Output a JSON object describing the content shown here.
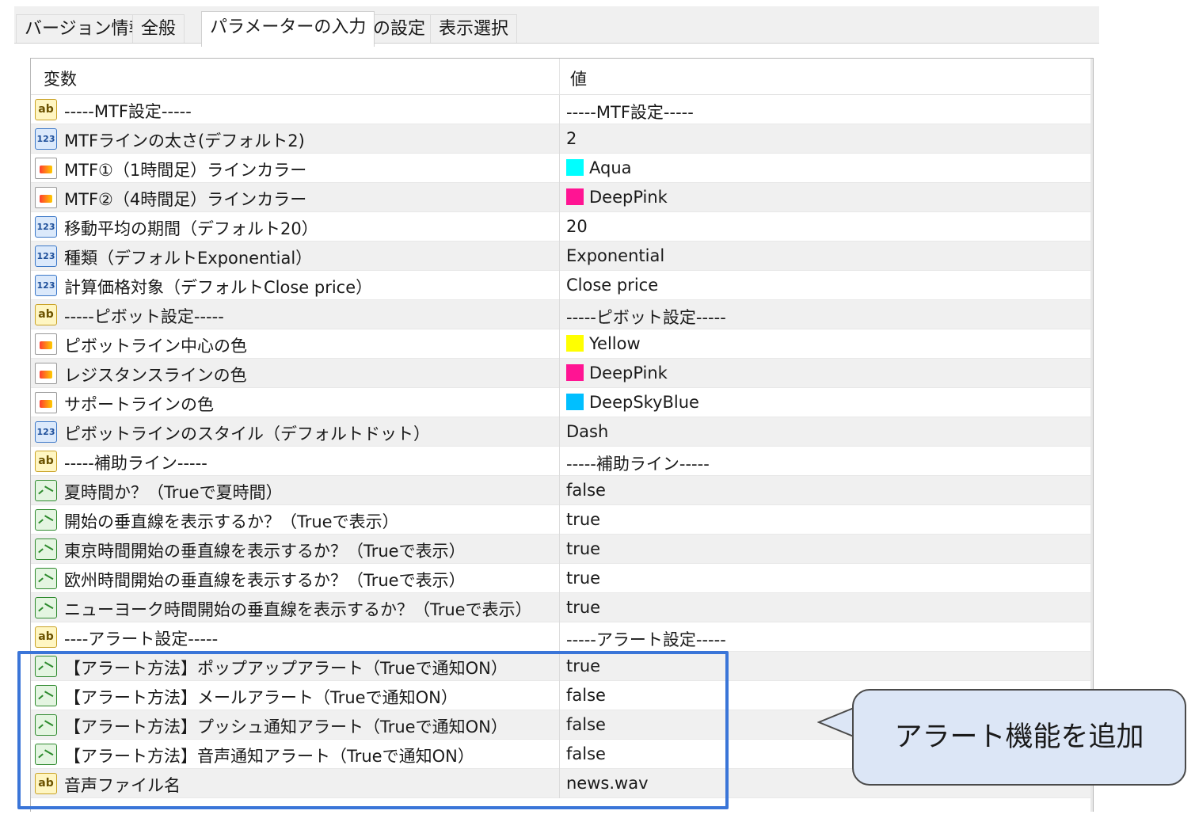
{
  "tabs": [
    {
      "label": "バージョン情報",
      "active": false
    },
    {
      "label": "全般",
      "active": false
    },
    {
      "label": "パラメーターの入力",
      "active": true
    },
    {
      "label": "色の設定",
      "active": false
    },
    {
      "label": "表示選択",
      "active": false
    }
  ],
  "grid": {
    "header": {
      "variable": "変数",
      "value": "値"
    },
    "rows": [
      {
        "type": "ab",
        "icon": "text-type-icon",
        "name": "-----MTF設定-----",
        "value": "-----MTF設定-----"
      },
      {
        "type": "123",
        "icon": "number-type-icon",
        "name": "MTFラインの太さ(デフォルト2)",
        "value": "2"
      },
      {
        "type": "color",
        "icon": "color-type-icon",
        "name": "MTF①（1時間足）ラインカラー",
        "value": "Aqua",
        "swatch": "#00ffff"
      },
      {
        "type": "color",
        "icon": "color-type-icon",
        "name": "MTF②（4時間足）ラインカラー",
        "value": "DeepPink",
        "swatch": "#ff1493"
      },
      {
        "type": "123",
        "icon": "number-type-icon",
        "name": "移動平均の期間（デフォルト20）",
        "value": "20"
      },
      {
        "type": "123",
        "icon": "number-type-icon",
        "name": "種類（デフォルトExponential）",
        "value": "Exponential"
      },
      {
        "type": "123",
        "icon": "number-type-icon",
        "name": "計算価格対象（デフォルトClose price）",
        "value": "Close price"
      },
      {
        "type": "ab",
        "icon": "text-type-icon",
        "name": "-----ピボット設定-----",
        "value": "-----ピボット設定-----"
      },
      {
        "type": "color",
        "icon": "color-type-icon",
        "name": "ピボットライン中心の色",
        "value": "Yellow",
        "swatch": "#ffff00"
      },
      {
        "type": "color",
        "icon": "color-type-icon",
        "name": "レジスタンスラインの色",
        "value": "DeepPink",
        "swatch": "#ff1493"
      },
      {
        "type": "color",
        "icon": "color-type-icon",
        "name": "サポートラインの色",
        "value": "DeepSkyBlue",
        "swatch": "#00bfff"
      },
      {
        "type": "123",
        "icon": "number-type-icon",
        "name": "ピボットラインのスタイル（デフォルトドット）",
        "value": "Dash"
      },
      {
        "type": "ab",
        "icon": "text-type-icon",
        "name": "-----補助ライン-----",
        "value": "-----補助ライン-----"
      },
      {
        "type": "bool",
        "icon": "bool-type-icon",
        "name": "夏時間か？（Trueで夏時間）",
        "value": "false"
      },
      {
        "type": "bool",
        "icon": "bool-type-icon",
        "name": "開始の垂直線を表示するか？（Trueで表示）",
        "value": "true"
      },
      {
        "type": "bool",
        "icon": "bool-type-icon",
        "name": "東京時間開始の垂直線を表示するか？（Trueで表示）",
        "value": "true"
      },
      {
        "type": "bool",
        "icon": "bool-type-icon",
        "name": "欧州時間開始の垂直線を表示するか？（Trueで表示）",
        "value": "true"
      },
      {
        "type": "bool",
        "icon": "bool-type-icon",
        "name": "ニューヨーク時間開始の垂直線を表示するか？（Trueで表示）",
        "value": "true"
      },
      {
        "type": "ab",
        "icon": "text-type-icon",
        "name": "----アラート設定-----",
        "value": "-----アラート設定-----"
      },
      {
        "type": "bool",
        "icon": "bool-type-icon",
        "name": "【アラート方法】ポップアップアラート（Trueで通知ON）",
        "value": "true"
      },
      {
        "type": "bool",
        "icon": "bool-type-icon",
        "name": "【アラート方法】メールアラート（Trueで通知ON）",
        "value": "false"
      },
      {
        "type": "bool",
        "icon": "bool-type-icon",
        "name": "【アラート方法】プッシュ通知アラート（Trueで通知ON）",
        "value": "false"
      },
      {
        "type": "bool",
        "icon": "bool-type-icon",
        "name": "【アラート方法】音声通知アラート（Trueで通知ON）",
        "value": "false"
      },
      {
        "type": "ab",
        "icon": "text-type-icon",
        "name": "音声ファイル名",
        "value": "news.wav"
      }
    ]
  },
  "annotation": {
    "callout_text": "アラート機能を追加",
    "highlight_color": "#3a75d8",
    "callout_bg": "#dce6f6"
  }
}
